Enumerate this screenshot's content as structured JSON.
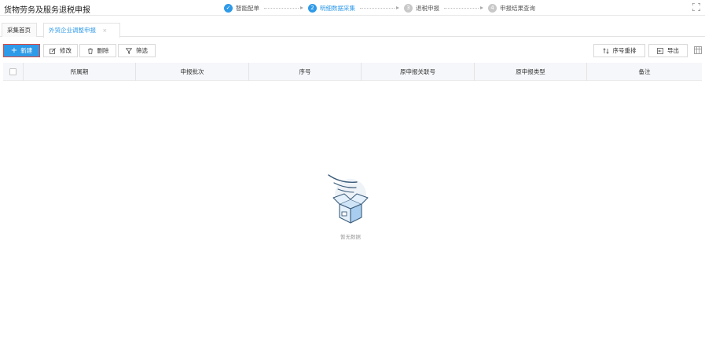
{
  "header": {
    "title": "货物劳务及服务退税申报",
    "steps": [
      {
        "label": "智能配单",
        "number": "✓",
        "state": "done"
      },
      {
        "label": "明细数据采集",
        "number": "2",
        "state": "active"
      },
      {
        "label": "退税申报",
        "number": "3",
        "state": "pending"
      },
      {
        "label": "申报结果查询",
        "number": "4",
        "state": "pending"
      }
    ]
  },
  "tabs": [
    {
      "label": "采集首页"
    },
    {
      "label": "外贸企业调整申报",
      "close": "×"
    }
  ],
  "toolbar": {
    "new_label": "新建",
    "edit_label": "修改",
    "delete_label": "删除",
    "filter_label": "筛选",
    "reorder_label": "序号重排",
    "export_label": "导出"
  },
  "table": {
    "columns": [
      "所属期",
      "申报批次",
      "序号",
      "原申报关联号",
      "原申报类型",
      "备注"
    ],
    "rows": []
  },
  "empty_state": {
    "text": "暂无数据"
  },
  "colors": {
    "accent": "#2f9ae8",
    "highlight_border": "#e0483d",
    "header_bg": "#f5f7fa"
  }
}
